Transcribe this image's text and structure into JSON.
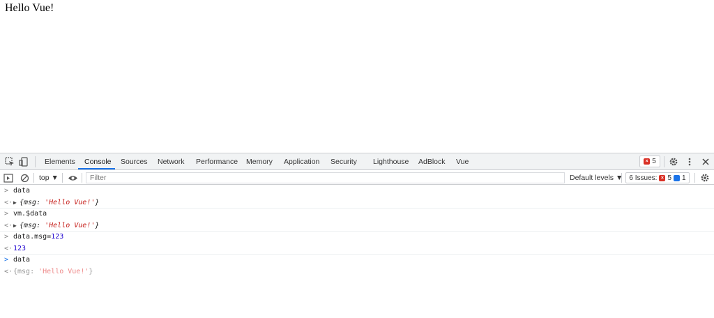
{
  "page": {
    "heading": "Hello Vue!"
  },
  "devtools": {
    "tabs": [
      {
        "label": "Elements"
      },
      {
        "label": "Console"
      },
      {
        "label": "Sources"
      },
      {
        "label": "Network"
      },
      {
        "label": "Performance"
      },
      {
        "label": "Memory"
      },
      {
        "label": "Application"
      },
      {
        "label": "Security"
      },
      {
        "label": "Lighthouse"
      },
      {
        "label": "AdBlock"
      },
      {
        "label": "Vue"
      }
    ],
    "active_tab": "Console",
    "error_count": "5",
    "colors": {
      "accent": "#1a73e8",
      "error": "#d93025",
      "string": "#c41a16",
      "number": "#1c00cf"
    }
  },
  "console_toolbar": {
    "context": "top ▼",
    "filter_placeholder": "Filter",
    "levels": "Default levels ▼",
    "issues_label": "6 Issues:",
    "issues_errors": "5",
    "issues_info": "1"
  },
  "console": {
    "rows": [
      {
        "input": "data"
      },
      {
        "output_open": "{msg: ",
        "output_str": "'Hello Vue!'",
        "output_close": "}"
      },
      {
        "input": "vm.$data"
      },
      {
        "output_open": "{msg: ",
        "output_str": "'Hello Vue!'",
        "output_close": "}"
      },
      {
        "input_prefix": "data.msg=",
        "input_num": "123"
      },
      {
        "output_num": "123"
      },
      {
        "input": "data"
      },
      {
        "eager_open": "{msg: ",
        "eager_str": "'Hello Vue!'",
        "eager_close": "}"
      }
    ]
  }
}
